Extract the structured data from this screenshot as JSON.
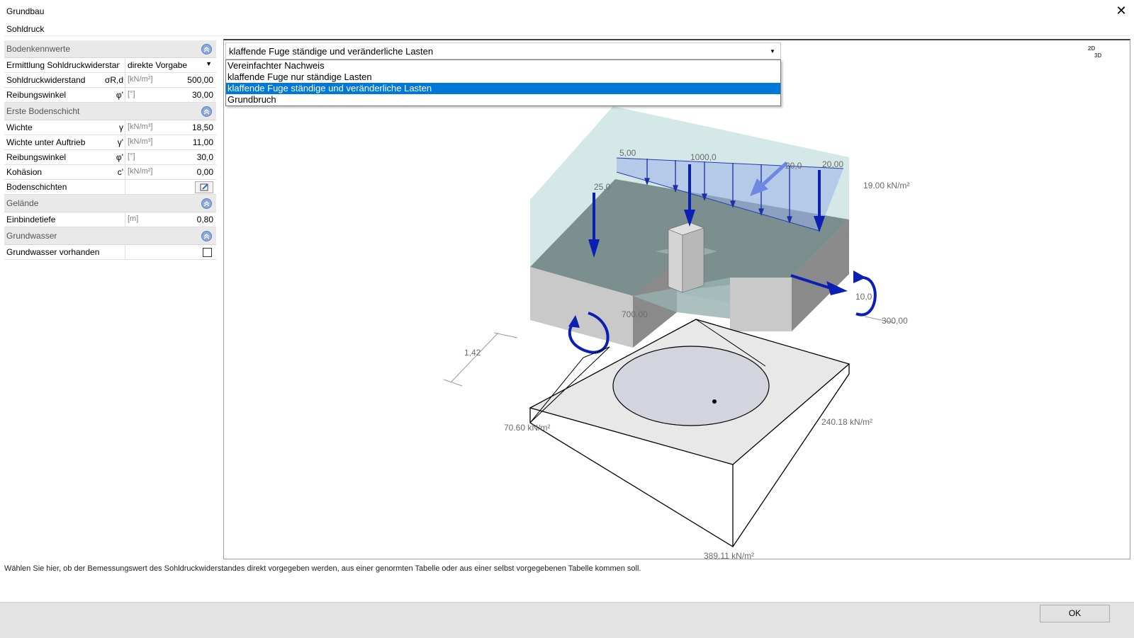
{
  "window": {
    "title": "Grundbau",
    "subtitle": "Sohldruck",
    "close_glyph": "✕"
  },
  "sections": {
    "bodenkennwerte": "Bodenkennwerte",
    "erste_bodenschicht": "Erste Bodenschicht",
    "gelaende": "Gelände",
    "grundwasser": "Grundwasser"
  },
  "rows": {
    "ermittlung": {
      "label": "Ermittlung Sohldruckwiderstand",
      "value": "direkte Vorgabe"
    },
    "sohldruckwiderstand": {
      "label": "Sohldruckwiderstand",
      "symbol": "σR,d",
      "unit": "[kN/m²]",
      "value": "500,00"
    },
    "reibungswinkel1": {
      "label": "Reibungswinkel",
      "symbol": "φ'",
      "unit": "[°]",
      "value": "30,00"
    },
    "wichte": {
      "label": "Wichte",
      "symbol": "γ",
      "unit": "[kN/m³]",
      "value": "18,50"
    },
    "wichte_auftrieb": {
      "label": "Wichte unter Auftrieb",
      "symbol": "γ'",
      "unit": "[kN/m³]",
      "value": "11,00"
    },
    "reibungswinkel2": {
      "label": "Reibungswinkel",
      "symbol": "φ'",
      "unit": "[°]",
      "value": "30,0"
    },
    "kohaesion": {
      "label": "Kohäsion",
      "symbol": "c'",
      "unit": "[kN/m²]",
      "value": "0,00"
    },
    "bodenschichten": {
      "label": "Bodenschichten"
    },
    "einbindetiefe": {
      "label": "Einbindetiefe",
      "unit": "[m]",
      "value": "0,80"
    },
    "grundwasser_vorhanden": {
      "label": "Grundwasser vorhanden",
      "checked": false
    }
  },
  "combo": {
    "selected": "klaffende Fuge ständige und veränderliche Lasten",
    "options": [
      "Vereinfachter Nachweis",
      "klaffende Fuge nur ständige Lasten",
      "klaffende Fuge ständige und veränderliche Lasten",
      "Grundbruch"
    ],
    "selected_index": 2
  },
  "view_toggle": {
    "top": "2D",
    "bottom": "3D"
  },
  "graphic_labels": {
    "load_left": "5,00",
    "load_center": "1000,0",
    "load_right_a": "20,0",
    "load_right_b": "20,00",
    "force_left": "25,0",
    "pressure_top": "19.00 kN/m²",
    "horizontal": "10,0",
    "moment_value": "700,00",
    "dim_right": "300,00",
    "dim_left": "1,42",
    "pressure_left": "70.60 kN/m²",
    "pressure_right": "240.18 kN/m²",
    "pressure_bottom": "389.11 kN/m²"
  },
  "status_text": "Wählen Sie hier, ob der Bemessungswert des Sohldruckwiderstandes direkt vorgegeben werden, aus einer genormten Tabelle oder aus einer selbst vorgegebenen Tabelle kommen soll.",
  "ok_label": "OK",
  "colors": {
    "accent_select": "#0078d7",
    "arrow": "#0a1fb4",
    "water": "#cfe6e6"
  }
}
